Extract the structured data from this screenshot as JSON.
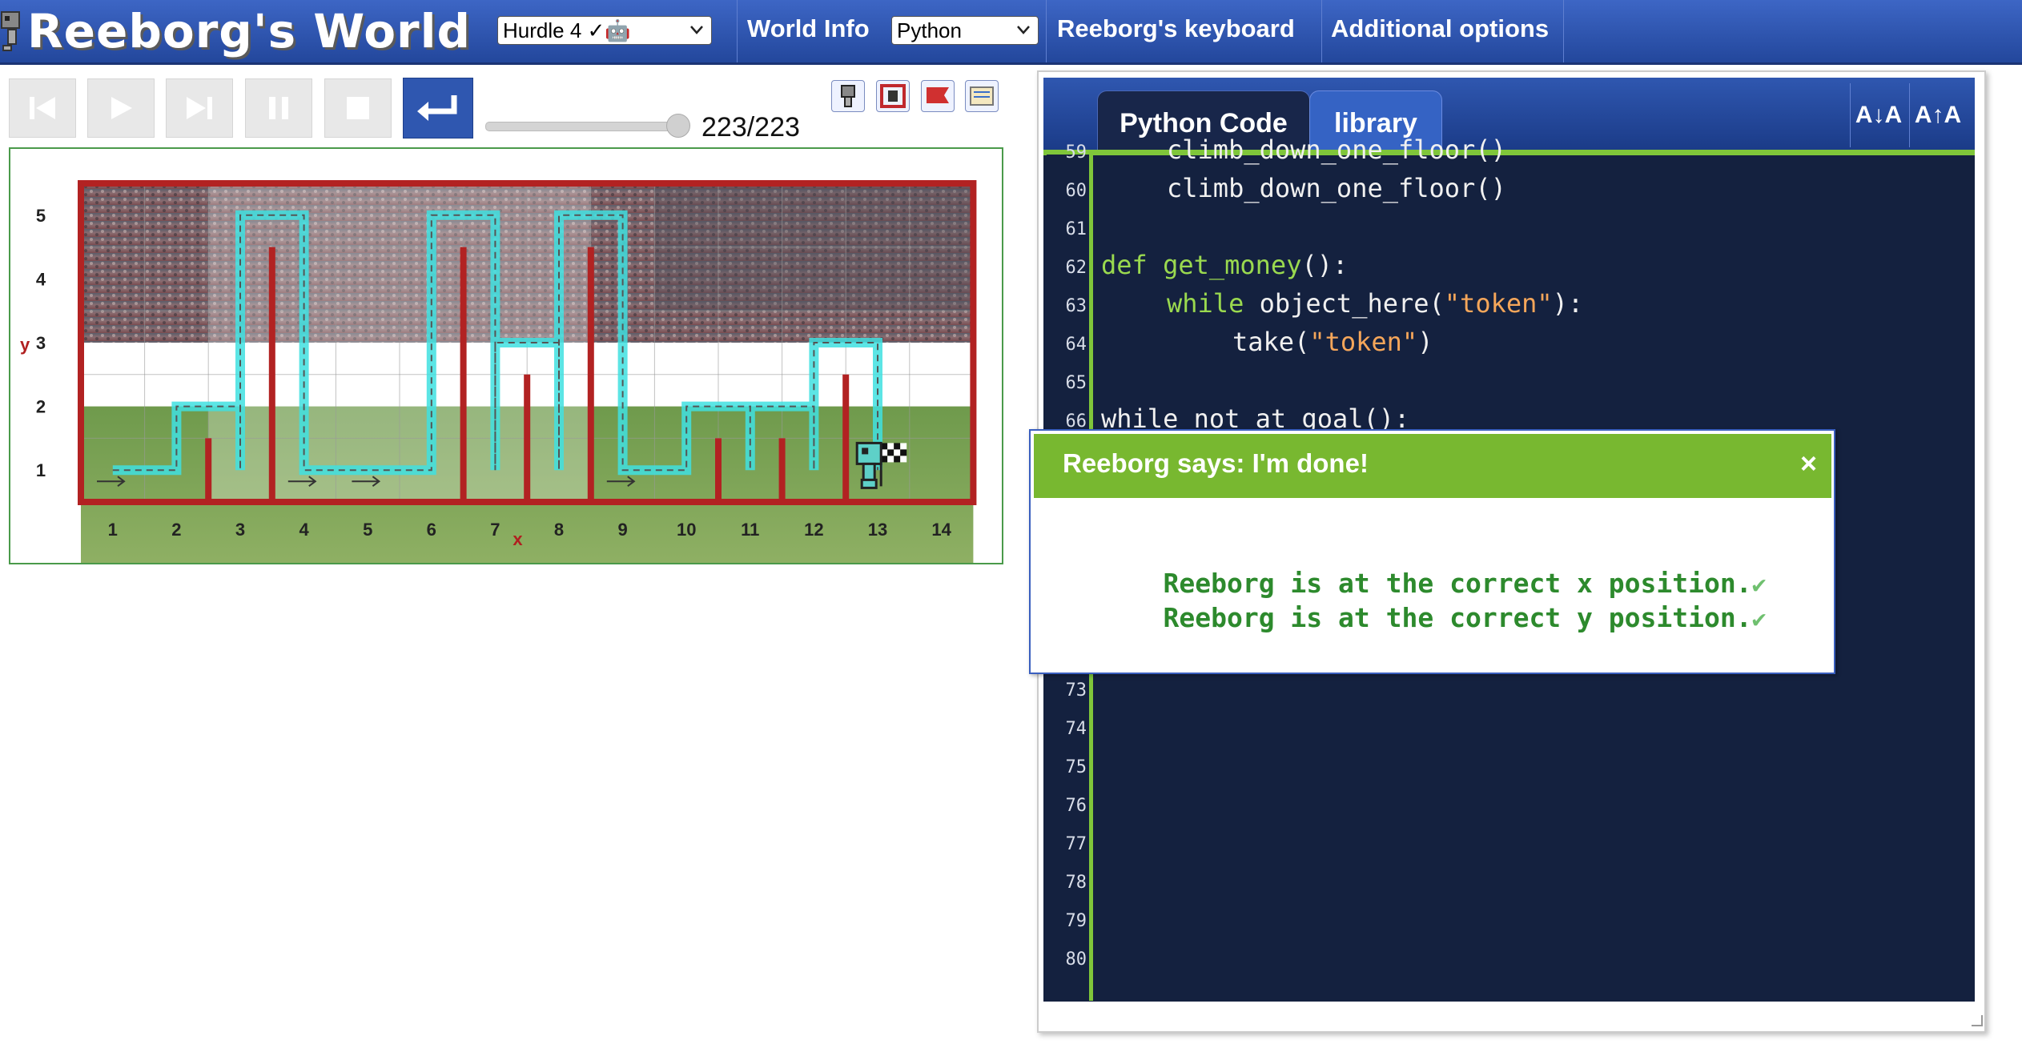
{
  "header": {
    "title": "Reeborg's World",
    "world_select": "Hurdle 4 ✓🤖",
    "world_info": "World Info",
    "language_select": "Python",
    "keyboard": "Reeborg's keyboard",
    "options": "Additional options"
  },
  "controls": {
    "step_counter": "223/223",
    "buttons": [
      "reverse-step",
      "run",
      "step",
      "pause",
      "stop",
      "reload"
    ],
    "progress": 1.0
  },
  "world": {
    "y_label": "y",
    "x_label": "x",
    "x_ticks": [
      "1",
      "2",
      "3",
      "4",
      "5",
      "6",
      "7",
      "8",
      "9",
      "10",
      "11",
      "12",
      "13",
      "14"
    ],
    "y_ticks": [
      "1",
      "2",
      "3",
      "4",
      "5"
    ]
  },
  "editor": {
    "tabs": [
      "Python Code",
      "library"
    ],
    "font_decrease": "A↓A",
    "font_increase": "A↑A",
    "lines": [
      {
        "n": "59",
        "indent": 1,
        "tokens": [
          {
            "t": "climb_down_one_floor()",
            "c": "plain"
          }
        ]
      },
      {
        "n": "60",
        "indent": 1,
        "tokens": [
          {
            "t": "climb_down_one_floor()",
            "c": "plain"
          }
        ]
      },
      {
        "n": "61",
        "indent": 0,
        "tokens": []
      },
      {
        "n": "62",
        "indent": 0,
        "tokens": [
          {
            "t": "def",
            "c": "kw"
          },
          {
            "t": " ",
            "c": "plain"
          },
          {
            "t": "get_money",
            "c": "fn"
          },
          {
            "t": "():",
            "c": "plain"
          }
        ]
      },
      {
        "n": "63",
        "indent": 1,
        "tokens": [
          {
            "t": "while",
            "c": "kw"
          },
          {
            "t": " object_here(",
            "c": "plain"
          },
          {
            "t": "\"token\"",
            "c": "str"
          },
          {
            "t": "):",
            "c": "plain"
          }
        ]
      },
      {
        "n": "64",
        "indent": 2,
        "tokens": [
          {
            "t": "take(",
            "c": "plain"
          },
          {
            "t": "\"token\"",
            "c": "str"
          },
          {
            "t": ")",
            "c": "plain"
          }
        ]
      },
      {
        "n": "65",
        "indent": 0,
        "tokens": []
      },
      {
        "n": "66",
        "indent": 0,
        "tokens": [
          {
            "t": "while not at_goal():",
            "c": "plain"
          }
        ]
      },
      {
        "n": "73",
        "indent": 0,
        "tokens": []
      },
      {
        "n": "74",
        "indent": 0,
        "tokens": []
      },
      {
        "n": "75",
        "indent": 0,
        "tokens": []
      },
      {
        "n": "76",
        "indent": 0,
        "tokens": []
      },
      {
        "n": "77",
        "indent": 0,
        "tokens": []
      },
      {
        "n": "78",
        "indent": 0,
        "tokens": []
      },
      {
        "n": "79",
        "indent": 0,
        "tokens": []
      },
      {
        "n": "80",
        "indent": 0,
        "tokens": []
      }
    ]
  },
  "dialog": {
    "title": "Reeborg says: I'm done!",
    "close": "×",
    "messages": [
      "Reeborg is at the correct x position.",
      "Reeborg is at the correct y position."
    ]
  },
  "colors": {
    "header_blue": "#2f57b0",
    "editor_bg": "#14213f",
    "accent_green": "#7fc63a",
    "wall_red": "#b22222",
    "trace_cyan": "#40e0e0"
  }
}
